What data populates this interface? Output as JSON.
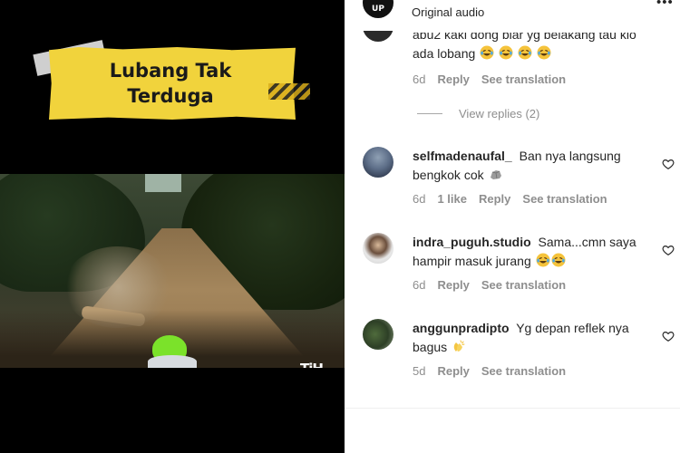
{
  "video": {
    "banner_line1": "Lubang Tak",
    "banner_line2": "Terduga",
    "watermark": "TiH"
  },
  "header": {
    "avatar_text": "UP",
    "audio_label": "Original audio",
    "more_label": "•••"
  },
  "partial_comment": {
    "text": "abu2 kaki dong biar yg belakang tau klo ada lobang",
    "emoji_icons": [
      "laughing-tears-icon",
      "laughing-tears-icon",
      "laughing-tears-icon",
      "laughing-tears-icon"
    ],
    "time": "6d",
    "reply": "Reply",
    "see_translation": "See translation",
    "view_replies": "View replies (2)"
  },
  "comments": [
    {
      "username": "selfmadenaufal_",
      "text": "Ban nya langsung bengkok cok",
      "emoji_icons": [
        "rock-icon"
      ],
      "time": "6d",
      "likes": "1 like",
      "reply": "Reply",
      "see_translation": "See translation"
    },
    {
      "username": "indra_puguh.studio",
      "text": "Sama...cmn saya hampir masuk jurang",
      "emoji_icons": [
        "laughing-tears-icon",
        "laughing-tears-icon"
      ],
      "time": "6d",
      "reply": "Reply",
      "see_translation": "See translation"
    },
    {
      "username": "anggunpradipto",
      "text": "Yg depan reflek nya bagus",
      "emoji_icons": [
        "clapping-hands-icon"
      ],
      "time": "5d",
      "reply": "Reply",
      "see_translation": "See translation"
    }
  ],
  "colors": {
    "meta_gray": "#8e8e8e",
    "text_dark": "#262626",
    "banner_yellow": "#f1d33c",
    "helmet_green": "#7be22a"
  }
}
